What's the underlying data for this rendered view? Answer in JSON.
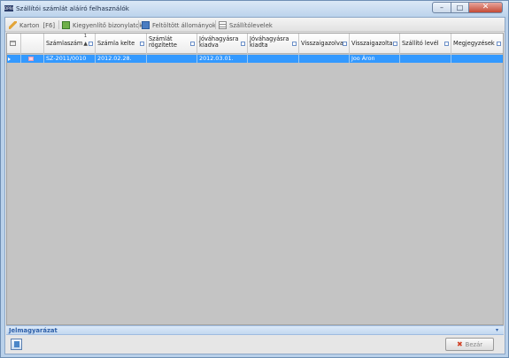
{
  "window": {
    "title": "Szállítói számlát aláíró felhasználók",
    "app_icon_text": "DPR4",
    "controls": {
      "minimize": "–",
      "maximize": "□",
      "close": "✕"
    }
  },
  "toolbar": {
    "items": [
      {
        "label": "Karton",
        "shortcut": "[F6]",
        "icon": "pencil-icon"
      },
      {
        "label": "Kiegyenlítő bizonylatok",
        "icon": "document-green-icon"
      },
      {
        "label": "Feltöltött állományok",
        "icon": "folder-upload-icon"
      },
      {
        "label": "Szállítólevelek",
        "icon": "document-lines-icon"
      }
    ]
  },
  "grid": {
    "columns": [
      {
        "label": ""
      },
      {
        "label": "Számlaszám",
        "sorted": "ascending",
        "sort_order": "1"
      },
      {
        "label": "Számla kelte"
      },
      {
        "label": "Számlát rögzítette"
      },
      {
        "label": "Jóváhagyásra kiadva"
      },
      {
        "label": "Jóváhagyásra kiadta"
      },
      {
        "label": "Visszaigazolva"
      },
      {
        "label": "Visszaigazolta"
      },
      {
        "label": "Szállító levél"
      },
      {
        "label": "Megjegyzések"
      }
    ],
    "rows": [
      {
        "selected": true,
        "cells": [
          "",
          "SZ-2011/0010",
          "2012.02.28.",
          "",
          "2012.03.01.",
          "",
          "",
          "Joo Áron",
          "",
          ""
        ]
      }
    ]
  },
  "legend": {
    "label": "Jelmagyarázat",
    "arrow": "▾"
  },
  "footer": {
    "excel_icon": "export-excel-icon",
    "close_label": "Bezár"
  },
  "colors": {
    "selection": "#3399ff",
    "legend_text": "#2e5fa8",
    "grid_bg": "#c4c4c4"
  }
}
